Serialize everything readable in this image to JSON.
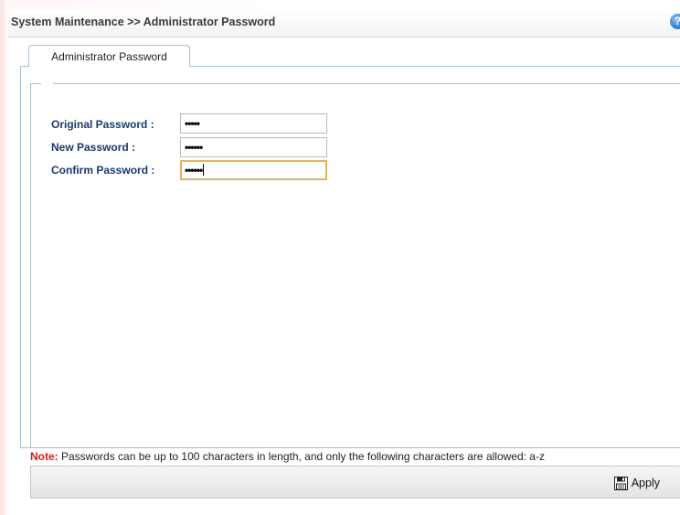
{
  "header": {
    "title": "System Maintenance >> Administrator Password",
    "help_icon": "?"
  },
  "tabs": [
    {
      "label": "Administrator Password",
      "selected": true
    }
  ],
  "form": {
    "original_password": {
      "label": "Original Password :",
      "masked_value": "•••••"
    },
    "new_password": {
      "label": "New Password :",
      "masked_value": "••••••"
    },
    "confirm_password": {
      "label": "Confirm Password :",
      "masked_value": "••••••"
    }
  },
  "note": {
    "label": "Note:",
    "text": " Passwords can be up to 100 characters in length, and only the following characters are allowed: a-z"
  },
  "footer": {
    "apply_label": "Apply",
    "apply_icon": "save-icon"
  },
  "colors": {
    "label_text": "#1b3a6b",
    "note_label": "#e01919",
    "focus_border": "#e5b260",
    "panel_border": "#a9bdd3"
  }
}
